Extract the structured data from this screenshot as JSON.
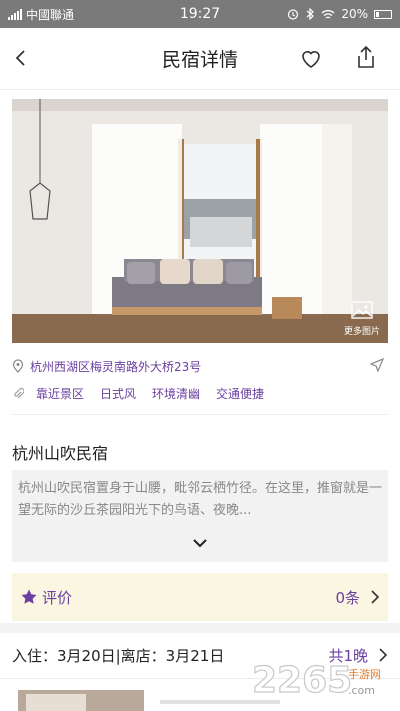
{
  "status_bar": {
    "carrier": "中國聯通",
    "time": "19:27",
    "battery": "20%",
    "icons": [
      "signal-icon",
      "alarm-icon",
      "bluetooth-icon",
      "wifi-icon",
      "battery-icon"
    ]
  },
  "header": {
    "title": "民宿详情",
    "icons": [
      "back-arrow-icon",
      "heart-icon",
      "share-icon"
    ]
  },
  "photo": {
    "more_label": "更多图片"
  },
  "listing": {
    "address": "杭州西湖区梅灵南路外大桥23号",
    "tags": [
      "靠近景区",
      "日式风",
      "环境清幽",
      "交通便捷"
    ],
    "name": "杭州山吹民宿",
    "description": "杭州山吹民宿置身于山腰，毗邻云栖竹径。在这里，推窗就是一望无际的沙丘茶园阳光下的鸟语、夜晚..."
  },
  "reviews": {
    "label": "评价",
    "count": "0条"
  },
  "stay": {
    "dates": "入住：3月20日|离店：3月21日",
    "nights": "共1晚"
  },
  "watermark": {
    "brand": "2265",
    "sub": "手游网",
    "site": ".com"
  },
  "colors": {
    "accent": "#6a3fa0",
    "review_bg": "#fbf6e1",
    "status_bar": "#7a7a7a"
  }
}
